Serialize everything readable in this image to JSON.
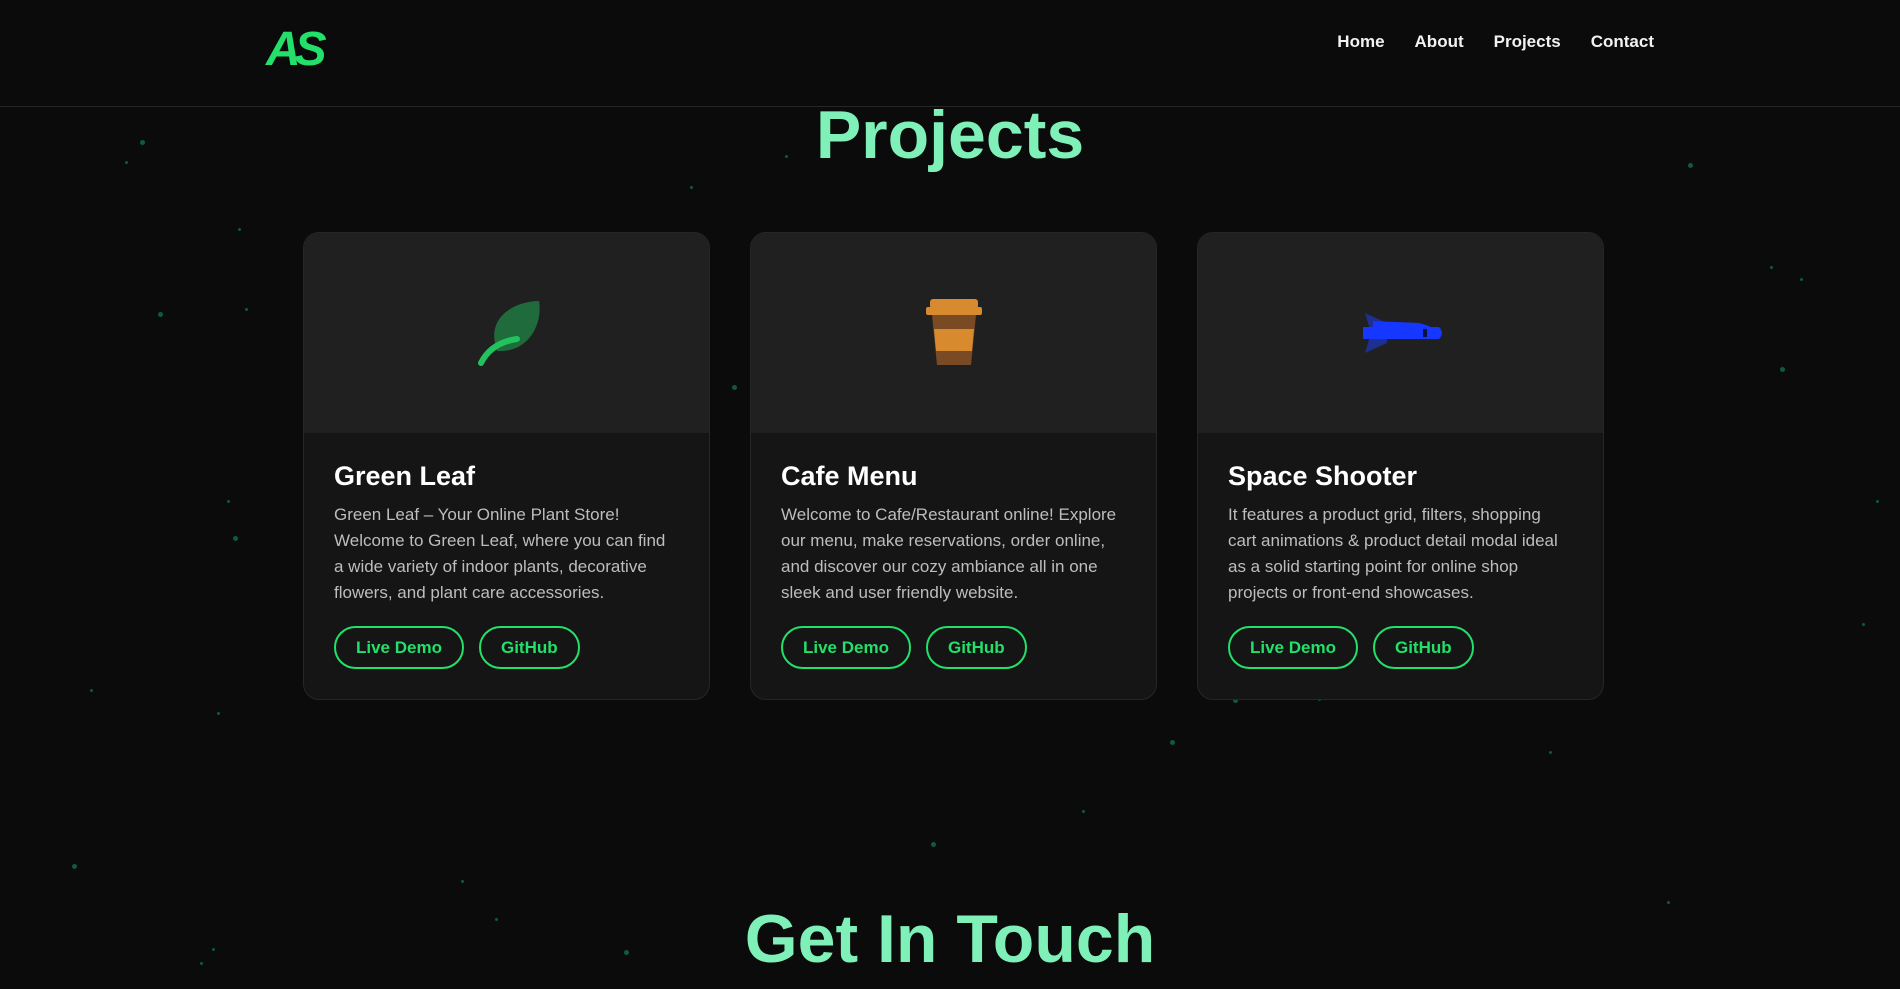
{
  "brand": {
    "logo": "AS",
    "accent": "#22e06a",
    "heading_color": "#7ff0b8"
  },
  "nav": {
    "items": [
      "Home",
      "About",
      "Projects",
      "Contact"
    ]
  },
  "projects": {
    "title": "Projects",
    "cards": [
      {
        "icon": "leaf-icon",
        "title": "Green Leaf",
        "description": "Green Leaf – Your Online Plant Store! Welcome to Green Leaf, where you can find a wide variety of indoor plants, decorative flowers, and plant care accessories.",
        "live_label": "Live Demo",
        "github_label": "GitHub"
      },
      {
        "icon": "coffee-cup-icon",
        "title": "Cafe Menu",
        "description": "Welcome to Cafe/Restaurant online! Explore our menu, make reservations, order online, and discover our cozy ambiance all in one sleek and user friendly website.",
        "live_label": "Live Demo",
        "github_label": "GitHub"
      },
      {
        "icon": "spaceship-icon",
        "title": "Space Shooter",
        "description": "It features a product grid, filters, shopping cart animations & product detail modal ideal as a solid starting point for online shop projects or front-end showcases.",
        "live_label": "Live Demo",
        "github_label": "GitHub"
      }
    ]
  },
  "contact": {
    "title": "Get In Touch"
  }
}
